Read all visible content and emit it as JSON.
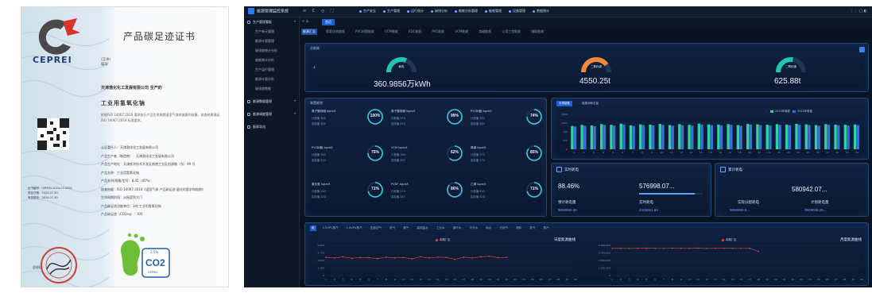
{
  "certificate": {
    "logo_text": "CEPREI",
    "title": "产品碳足迹证书",
    "code_lines": [
      "(正本)",
      "编号"
    ],
    "company": "天津渤化化工发展有限公司 生产的",
    "product": "工业用氢氧化钠",
    "paragraph": "依据ISO 14067:2018 要求执行产品生命周期温室气体排放量的核算，核查结果满足ISO 14067:2018 标准要求。",
    "lines": [
      "认证委托人：天津渤化化工发展有限公司",
      "产品生产者（制造商）：天津渤化化工发展有限公司",
      "产品生产地址：天津经济技术开发区南港工业区创源路（东）99 号",
      "产品名称：工业用氢氧化钠",
      "产品系列/规格/型号：8.45（45%）",
      "核查依据：ISO 14067:2018《温室气体 产品碳足迹 量化的要求和指南》",
      "生命周期阶段：从摇篮到大门",
      "产品碳足迹功能单位：1吨 工业用氢氧化钠",
      "产品碳足迹（CO2eq）：XXt"
    ],
    "meta_lines": [
      "证书编号：CEPREI-2024-CF-0002",
      "颁证日期：2023.07.30",
      "有效期至：2024.07.30"
    ],
    "signature_label": "总经理",
    "co2_label": "CO2",
    "co2_sub": "2.5%",
    "co2_footer": "CEPREI"
  },
  "app": {
    "brand": "能源管理监控系统",
    "tools": [
      "≡",
      "C",
      "◷",
      "⛶"
    ],
    "top_nav": [
      "生产安全",
      "生产管理",
      "运行统计",
      "碳排分析",
      "能耗分析管理",
      "能耗管理",
      "设备管理",
      "数据统计"
    ],
    "top_right": "⋮⋮  ▢  ◐",
    "sidebar": [
      {
        "type": "group",
        "label": "生产管理看板"
      },
      {
        "type": "sub",
        "label": "生产单元管理"
      },
      {
        "type": "sub",
        "label": "能源计量管理"
      },
      {
        "type": "sub",
        "label": "碳排放统计分析"
      },
      {
        "type": "sub",
        "label": "能耗统计分析"
      },
      {
        "type": "sub",
        "label": "生产运行管理"
      },
      {
        "type": "sub",
        "label": "能源计量分析"
      },
      {
        "type": "sub",
        "label": "碳排放数据"
      },
      {
        "type": "group",
        "label": "能源数据管理"
      },
      {
        "type": "group",
        "label": "能源调度管理"
      },
      {
        "type": "group2",
        "label": "报表导出"
      }
    ],
    "tabbar_nav": "«  ⌂",
    "current_tab": "首页",
    "sub_tabs": [
      "能源汇总",
      "氢氧化钠能耗",
      "PVC树脂能耗",
      "VCM能耗",
      "EDC能耗",
      "PVC能耗",
      "VCM能耗",
      "烧碱能耗",
      "公用工程能耗",
      "辅助能耗"
    ],
    "gauges_panel_title": "总能耗",
    "gauges": [
      {
        "label": "耗电",
        "value": "360.9856万kWh",
        "color": "#20c5b0",
        "fill": 0.62
      },
      {
        "label": "二氧化碳",
        "value": "4550.25t",
        "color": "#f08a3a",
        "fill": 0.8
      },
      {
        "label": "二氧化碳",
        "value": "625.88t",
        "color": "#20c5b0",
        "fill": 0.55
      }
    ],
    "gauges_prev": "‹",
    "rings_panel_title": "装置能效",
    "ring_metrics": [
      {
        "name": "离子膜烧碱 kgce/t",
        "l1": "计划值 300",
        "l2": "实际值 300",
        "pct": "100%",
        "fill": 1.0
      },
      {
        "name": "离子膜烧碱 kgce/t",
        "l1": "计划值 370",
        "l2": "实际值 370",
        "pct": "99%",
        "fill": 0.99
      },
      {
        "name": "PVC树脂 kgce/t",
        "l1": "计划值 330",
        "l2": "实际值 330",
        "pct": "74%",
        "fill": 0.74
      },
      {
        "name": "PVC树脂 kgce/t",
        "l1": "计划值 310",
        "l2": "实际值 310",
        "pct": "75%",
        "fill": 0.75
      },
      {
        "name": "VCM kgce/t",
        "l1": "计划值 260",
        "l2": "实际值 262",
        "pct": "62%",
        "fill": 0.62
      },
      {
        "name": "氯碱 kgce/t",
        "l1": "计划值 170",
        "l2": "实际值 172",
        "pct": "85%",
        "fill": 0.85
      },
      {
        "name": "氯化氢 kgce/t",
        "l1": "计划值 230",
        "l2": "实际值 228",
        "pct": "71%",
        "fill": 0.71
      },
      {
        "name": "PVDF kgce/t",
        "l1": "计划值 270",
        "l2": "实际值 267",
        "pct": "86%",
        "fill": 0.86
      },
      {
        "name": "乙烯 kgce/t",
        "l1": "计划值 310",
        "l2": "实际值 308",
        "pct": "71%",
        "fill": 0.71
      }
    ],
    "bar_tab": "分项能耗",
    "bar_title": "能源消耗总量",
    "bar_legend": [
      "2023年耗能",
      "2022年耗能"
    ],
    "kpi1": {
      "title": "实时耗电",
      "big_left": "88.46%",
      "big_right": "576998.07...",
      "lbl_left": "预计耗电量",
      "lbl_right": "实时耗电",
      "val_left": "5000000.00",
      "val_right": "4425001.93",
      "progress": 0.88
    },
    "kpi2": {
      "title": "累计耗电",
      "big": "580942.07...",
      "lbl_left": "实际分配耗电",
      "lbl_right": "计划耗电量",
      "val_left": "5000000.0...",
      "val_right": "3949028.25..."
    },
    "bottom_tabs": [
      "电",
      "1/2VPV蒸汽",
      "1.6VPV蒸汽",
      "压缩空气",
      "氮气",
      "氯气",
      "高纯盐水",
      "工业水",
      "循环水",
      "冷冻水",
      "纯水",
      "天然气",
      "燃料",
      "氢气",
      "蒸汽"
    ],
    "line_charts": [
      {
        "legend": "本期厂区",
        "title": "日度能源曲线"
      },
      {
        "legend": "本期厂区",
        "title": "月度能源曲线"
      }
    ]
  },
  "chart_data": [
    {
      "type": "bar",
      "title": "能源消耗总量",
      "categories": [
        "1",
        "2",
        "3",
        "4",
        "5",
        "6",
        "7",
        "8",
        "9",
        "10",
        "11",
        "12",
        "13",
        "14",
        "15",
        "16",
        "17",
        "18",
        "19",
        "20",
        "21",
        "22",
        "23",
        "24",
        "25",
        "26",
        "27",
        "28",
        "29",
        "30"
      ],
      "series": [
        {
          "name": "2023年耗能",
          "values": [
            1000,
            1050,
            1020,
            1080,
            1050,
            1100,
            1030,
            1070,
            1060,
            1090,
            1040,
            1080,
            1050,
            1100,
            1070,
            1060,
            1080,
            1040,
            1090,
            1070,
            1050,
            1080,
            1060,
            1090,
            1070,
            1040,
            1080,
            1060,
            1050,
            1070
          ]
        },
        {
          "name": "2022年耗能",
          "values": [
            980,
            1010,
            990,
            1050,
            1020,
            1060,
            1000,
            1040,
            1030,
            1050,
            1010,
            1040,
            1020,
            1060,
            1040,
            1030,
            1050,
            1010,
            1060,
            1040,
            1020,
            1050,
            1030,
            1060,
            1040,
            1010,
            1050,
            1030,
            1020,
            1040
          ]
        }
      ],
      "ylim": [
        0,
        1500
      ]
    },
    {
      "type": "line",
      "title": "日度能源曲线",
      "x": [
        "1",
        "2",
        "3",
        "4",
        "5",
        "6",
        "7",
        "8",
        "9",
        "10",
        "11",
        "12",
        "13",
        "14",
        "15",
        "16",
        "17",
        "18",
        "19",
        "20",
        "21",
        "22",
        "23",
        "24",
        "25",
        "26",
        "27",
        "28",
        "29",
        "30"
      ],
      "series": [
        {
          "name": "本期厂区",
          "values": [
            3000,
            2900,
            3100,
            2850,
            3000,
            2950,
            2800,
            3050,
            2900,
            3000,
            2750,
            3100,
            2900,
            3050,
            3000,
            2700,
            3050,
            2900,
            3100,
            3200,
            2950,
            3000
          ]
        }
      ],
      "ylim": [
        0,
        5000
      ]
    },
    {
      "type": "line",
      "title": "月度能源曲线",
      "x": [
        "1",
        "2",
        "3",
        "4",
        "5",
        "6",
        "7",
        "8",
        "9",
        "10",
        "11",
        "12",
        "13",
        "14",
        "15",
        "16",
        "17",
        "18",
        "19",
        "20",
        "21",
        "22",
        "23",
        "24",
        "25",
        "26",
        "27",
        "28",
        "29",
        "30"
      ],
      "series": [
        {
          "name": "本期厂区",
          "values": [
            4500000,
            4520000,
            4480000,
            4510000,
            4530000,
            4500000,
            4490000,
            4520000,
            4510000,
            4500000,
            4530000,
            4480000,
            4510000,
            4520000,
            4500000,
            4490000,
            4510000,
            4000000
          ]
        }
      ],
      "ylim": [
        0,
        5000000
      ]
    }
  ]
}
